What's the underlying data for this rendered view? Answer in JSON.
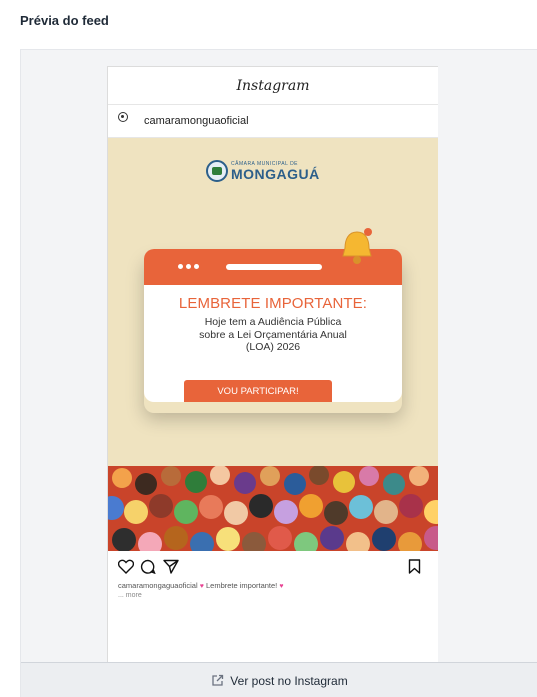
{
  "section": {
    "title": "Prévia do feed"
  },
  "post": {
    "app_name": "Instagram",
    "username": "camaramonguaoficial",
    "image": {
      "brand_small": "CÂMARA MUNICIPAL DE",
      "brand_big": "MONGAGUÁ",
      "heading": "LEMBRETE IMPORTANTE:",
      "body_line1": "Hoje tem a Audiência Pública",
      "body_line2": "sobre a Lei Orçamentária Anual",
      "body_line3": "(LOA) 2026",
      "button": "VOU PARTICIPAR!"
    },
    "caption_user": "camaramongaguaoficial",
    "caption_text": "Lembrete importante!",
    "more": "... more"
  },
  "footer": {
    "link_label": "Ver post no Instagram",
    "icon": "external-link-icon"
  },
  "colors": {
    "accent": "#e8643a",
    "image_bg": "#efe3c0",
    "brand": "#2c5f8a"
  }
}
